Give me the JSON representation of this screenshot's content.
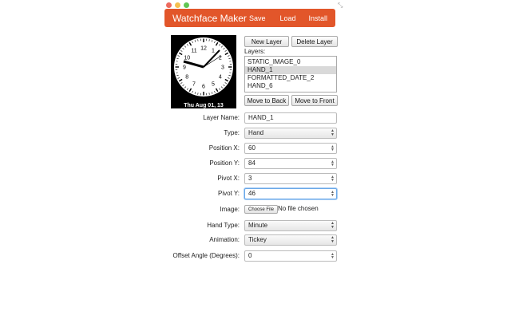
{
  "window": {
    "buttons": [
      "close",
      "minimize",
      "zoom"
    ]
  },
  "header": {
    "title": "Watchface Maker",
    "save_label": "Save",
    "load_label": "Load",
    "install_label": "Install",
    "color": "#e2562a"
  },
  "preview": {
    "numbers": [
      "12",
      "1",
      "2",
      "3",
      "4",
      "5",
      "6",
      "7",
      "8",
      "9",
      "10",
      "11"
    ],
    "date_text": "Thu Aug 01, 13"
  },
  "layer_controls": {
    "new_label": "New Layer",
    "delete_label": "Delete Layer",
    "layers_label": "Layers:",
    "move_back_label": "Move to Back",
    "move_front_label": "Move to Front"
  },
  "layers": [
    {
      "name": "STATIC_IMAGE_0",
      "selected": false
    },
    {
      "name": "HAND_1",
      "selected": true
    },
    {
      "name": "FORMATTED_DATE_2",
      "selected": false
    },
    {
      "name": "HAND_6",
      "selected": false
    }
  ],
  "form": {
    "layer_name": {
      "label": "Layer Name:",
      "value": "HAND_1"
    },
    "type": {
      "label": "Type:",
      "value": "Hand"
    },
    "position_x": {
      "label": "Position X:",
      "value": "60"
    },
    "position_y": {
      "label": "Position Y:",
      "value": "84"
    },
    "pivot_x": {
      "label": "Pivot X:",
      "value": "3"
    },
    "pivot_y": {
      "label": "Pivot Y:",
      "value": "46"
    },
    "image": {
      "label": "Image:",
      "button": "Choose File",
      "status": "No file chosen"
    },
    "hand_type": {
      "label": "Hand Type:",
      "value": "Minute"
    },
    "animation": {
      "label": "Animation:",
      "value": "Tickey"
    },
    "offset_angle": {
      "label": "Offset Angle (Degrees):",
      "value": "0"
    }
  }
}
